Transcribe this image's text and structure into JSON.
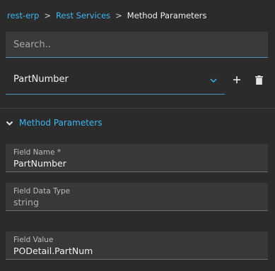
{
  "breadcrumb": {
    "items": [
      "rest-erp",
      "Rest Services"
    ],
    "separator": ">",
    "current": "Method Parameters"
  },
  "search": {
    "placeholder": "Search..",
    "value": ""
  },
  "selector": {
    "selected": "PartNumber"
  },
  "icons": {
    "dropdown": "chevron-down-icon",
    "add": "plus-icon",
    "delete": "trash-icon",
    "section_toggle": "chevron-down-icon"
  },
  "section": {
    "title": "Method Parameters"
  },
  "fields": [
    {
      "label": "Field Name *",
      "value": "PartNumber"
    },
    {
      "label": "Field Data Type",
      "value": "string"
    },
    {
      "label": "Field Value",
      "value": "PODetail.PartNum"
    }
  ],
  "colors": {
    "accent": "#3fb6f2",
    "background": "#2b2b2b",
    "field_background": "#383838"
  }
}
